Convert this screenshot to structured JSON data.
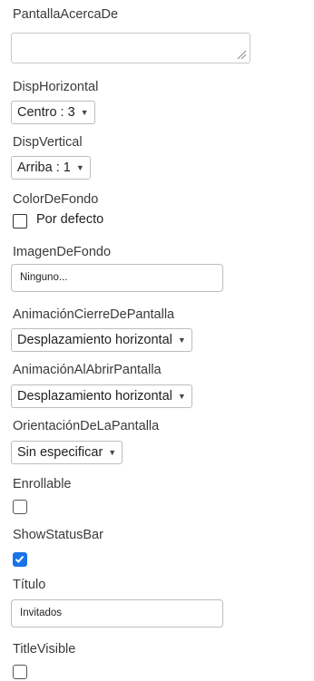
{
  "properties": {
    "about_screen": {
      "label": "PantallaAcercaDe",
      "value": ""
    },
    "align_horizontal": {
      "label": "DispHorizontal",
      "value": "Centro : 3"
    },
    "align_vertical": {
      "label": "DispVertical",
      "value": "Arriba : 1"
    },
    "background_color": {
      "label": "ColorDeFondo",
      "value": "Por defecto"
    },
    "background_image": {
      "label": "ImagenDeFondo",
      "value": "Ninguno..."
    },
    "close_animation": {
      "label": "AnimaciónCierreDePantalla",
      "value": "Desplazamiento horizontal"
    },
    "open_animation": {
      "label": "AnimaciónAlAbrirPantalla",
      "value": "Desplazamiento horizontal"
    },
    "screen_orientation": {
      "label": "OrientaciónDeLaPantalla",
      "value": "Sin especificar"
    },
    "scrollable": {
      "label": "Enrollable",
      "checked": false
    },
    "show_status_bar": {
      "label": "ShowStatusBar",
      "checked": true
    },
    "title": {
      "label": "Título",
      "value": "Invitados"
    },
    "title_visible": {
      "label": "TitleVisible",
      "checked": false
    }
  },
  "caret_glyph": "▼",
  "colors": {
    "checked": "#1a73e8",
    "label": "#3a3a3a"
  }
}
